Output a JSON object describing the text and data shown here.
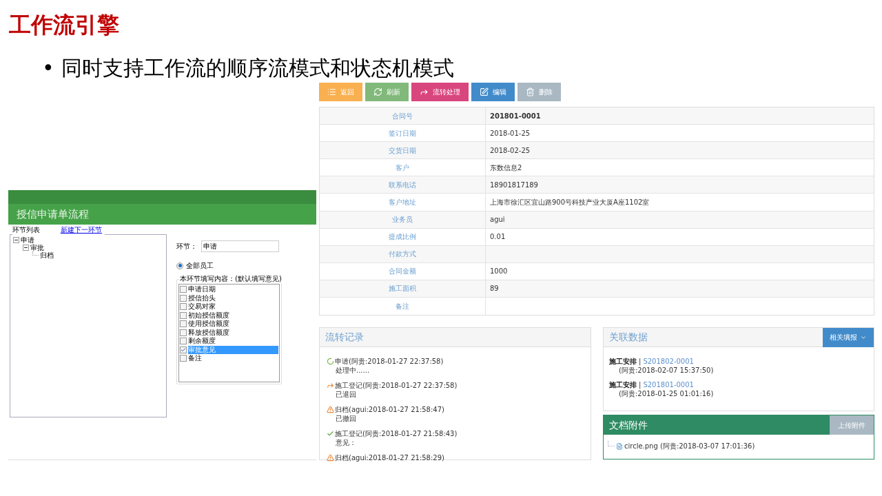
{
  "slide": {
    "title": "工作流引擎",
    "bullet_mark": "•",
    "bullet": "同时支持工作流的顺序流模式和状态机模式"
  },
  "flow_designer": {
    "title": "授信申请单流程",
    "tree_label": "环节列表",
    "new_link": "新建下一环节",
    "tree": [
      {
        "label": "申请",
        "expanded": true,
        "children": [
          {
            "label": "审批",
            "expanded": true,
            "children": [
              {
                "label": "归档"
              }
            ]
          }
        ]
      }
    ],
    "step_label": "环节：",
    "step_value": "申请",
    "radio": {
      "label": "全部员工",
      "selected": true
    },
    "fields_legend": "本环节填写内容：(默认填写意见)",
    "fields": [
      {
        "label": "申请日期",
        "checked": false,
        "selected": false
      },
      {
        "label": "授信抬头",
        "checked": false,
        "selected": false
      },
      {
        "label": "交易对家",
        "checked": false,
        "selected": false
      },
      {
        "label": "初始授信额度",
        "checked": false,
        "selected": false
      },
      {
        "label": "使用授信额度",
        "checked": false,
        "selected": false
      },
      {
        "label": "释放授信额度",
        "checked": false,
        "selected": false
      },
      {
        "label": "剩余额度",
        "checked": false,
        "selected": false
      },
      {
        "label": "审批意见",
        "checked": true,
        "selected": true
      },
      {
        "label": "备注",
        "checked": false,
        "selected": false
      }
    ]
  },
  "toolbar": [
    {
      "kind": "list",
      "label": "返回",
      "color": "#f9b050"
    },
    {
      "kind": "refresh",
      "label": "刷新",
      "color": "#80b97a"
    },
    {
      "kind": "share",
      "label": "流转处理",
      "color": "#d9457d"
    },
    {
      "kind": "edit",
      "label": "编辑",
      "color": "#428bca"
    },
    {
      "kind": "trash",
      "label": "删除",
      "color": "#a9b8c2"
    }
  ],
  "details": [
    {
      "label": "合同号",
      "value": "201801-0001",
      "bold": true
    },
    {
      "label": "签订日期",
      "value": "2018-01-25",
      "bold": false
    },
    {
      "label": "交货日期",
      "value": "2018-02-25",
      "bold": false
    },
    {
      "label": "客户",
      "value": "东数信息2",
      "bold": false
    },
    {
      "label": "联系电话",
      "value": "18901817189",
      "bold": false
    },
    {
      "label": "客户地址",
      "value": "上海市徐汇区宜山路900号科技产业大厦A座1102室",
      "bold": false
    },
    {
      "label": "业务员",
      "value": "agui",
      "bold": false
    },
    {
      "label": "提成比例",
      "value": "0.01",
      "bold": false
    },
    {
      "label": "付款方式"
    },
    {
      "label": "合同金额",
      "value": "1000",
      "bold": false
    },
    {
      "label": "施工面积",
      "value": "89",
      "bold": false
    },
    {
      "label": "备注"
    }
  ],
  "flow_log": {
    "title": "流转记录",
    "items": [
      {
        "kind": "pending",
        "head": "申请(阿贵:2018-01-27 22:37:58)",
        "note": "处理中......"
      },
      {
        "kind": "returned",
        "head": "施工登记(阿贵:2018-01-27 22:37:58)",
        "note": "已退回"
      },
      {
        "kind": "warning",
        "head": "归档(agui:2018-01-27 21:58:47)",
        "note": "已撤回"
      },
      {
        "kind": "done",
        "head": "施工登记(阿贵:2018-01-27 21:58:43)",
        "note": "意见："
      },
      {
        "kind": "warning",
        "head": "归档(agui:2018-01-27 21:58:29)"
      }
    ]
  },
  "related": {
    "title": "关联数据",
    "button": "相关填报",
    "items": [
      {
        "type": "施工安排",
        "separator": "|",
        "code": "S201802-0001",
        "meta": "(阿贵:2018-02-07 15:37:50)"
      },
      {
        "type": "施工安排",
        "separator": "|",
        "code": "S201801-0001",
        "meta": "(阿贵:2018-01-25 01:01:16)"
      }
    ]
  },
  "attachments": {
    "title": "文档附件",
    "button": "上传附件",
    "files": [
      {
        "name": "circle.png (阿贵:2018-03-07 17:01:36)"
      }
    ]
  }
}
